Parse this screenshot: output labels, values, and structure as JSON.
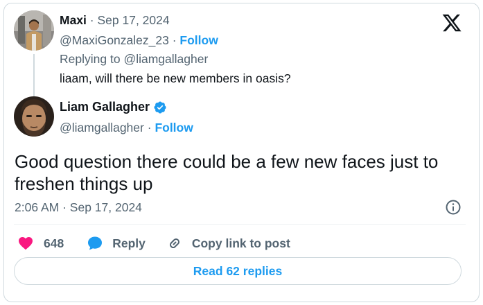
{
  "brand": {
    "logo_icon": "x-logo-icon"
  },
  "parent_tweet": {
    "author_name": "Maxi",
    "separator": "·",
    "date": "Sep 17, 2024",
    "handle": "@MaxiGonzalez_23",
    "follow_label": "Follow",
    "replying_prefix": "Replying to",
    "replying_to": "@liamgallagher",
    "text": "liaam, will there be new members in oasis?"
  },
  "main_tweet": {
    "author_name": "Liam Gallagher",
    "verified": true,
    "verified_icon": "verified-badge-icon",
    "handle": "@liamgallagher",
    "separator": "·",
    "follow_label": "Follow",
    "text": "Good question there could be a few new faces just to freshen things up",
    "time": "2:06 AM",
    "date": "Sep 17, 2024"
  },
  "actions": {
    "likes": "648",
    "like_icon": "heart-icon",
    "reply_label": "Reply",
    "reply_icon": "speech-bubble-icon",
    "copy_label": "Copy link to post",
    "copy_icon": "link-icon",
    "info_icon": "info-icon"
  },
  "footer": {
    "read_replies_label": "Read 62 replies"
  },
  "colors": {
    "accent": "#1d9bf0",
    "like": "#f91880",
    "text_primary": "#0f1419",
    "text_secondary": "#536471",
    "border": "#cfd9de"
  }
}
